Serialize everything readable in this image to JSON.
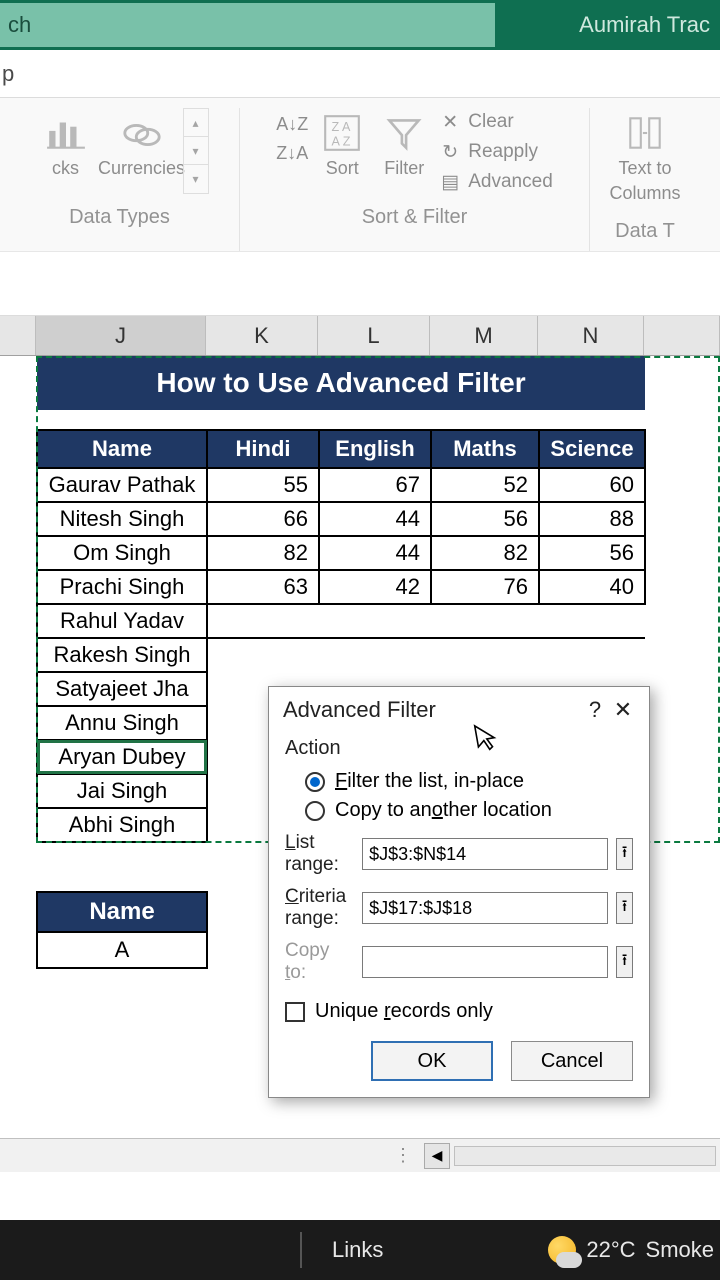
{
  "titlebar": {
    "search_text": "ch",
    "right_text": "Aumirah Trac"
  },
  "fnbar": {
    "text": "p"
  },
  "ribbon": {
    "data_types": {
      "stocks": "cks",
      "currencies": "Currencies",
      "group_label": "Data Types"
    },
    "sort_filter": {
      "sort": "Sort",
      "filter": "Filter",
      "clear": "Clear",
      "reapply": "Reapply",
      "advanced": "Advanced",
      "group_label": "Sort & Filter"
    },
    "data_tools": {
      "text_to_columns_l1": "Text to",
      "text_to_columns_l2": "Columns",
      "group_label": "Data T"
    }
  },
  "columns": {
    "J": "J",
    "K": "K",
    "L": "L",
    "M": "M",
    "N": "N"
  },
  "banner": "How to Use Advanced Filter",
  "headers": {
    "name": "Name",
    "hindi": "Hindi",
    "english": "English",
    "maths": "Maths",
    "science": "Science"
  },
  "rows": [
    {
      "name": "Gaurav Pathak",
      "hindi": 55,
      "english": 67,
      "maths": 52,
      "science": 60
    },
    {
      "name": "Nitesh Singh",
      "hindi": 66,
      "english": 44,
      "maths": 56,
      "science": 88
    },
    {
      "name": "Om Singh",
      "hindi": 82,
      "english": 44,
      "maths": 82,
      "science": 56
    },
    {
      "name": "Prachi Singh",
      "hindi": 63,
      "english": 42,
      "maths": 76,
      "science": 40
    },
    {
      "name": "Rahul Yadav"
    },
    {
      "name": "Rakesh Singh"
    },
    {
      "name": "Satyajeet Jha"
    },
    {
      "name": "Annu Singh"
    },
    {
      "name": "Aryan Dubey"
    },
    {
      "name": "Jai Singh"
    },
    {
      "name": "Abhi Singh"
    }
  ],
  "criteria": {
    "header": "Name",
    "value": "A"
  },
  "dialog": {
    "title": "Advanced Filter",
    "action_label": "Action",
    "opt_inplace": "Filter the list, in-place",
    "opt_copy": "Copy to another location",
    "list_range_label": "List range:",
    "list_range_value": "$J$3:$N$14",
    "criteria_range_label": "Criteria range:",
    "criteria_range_value": "$J$17:$J$18",
    "copy_to_label": "Copy to:",
    "copy_to_value": "",
    "unique_label": "Unique records only",
    "ok": "OK",
    "cancel": "Cancel"
  },
  "statusbar": {
    "links": "Links"
  },
  "weather": {
    "temp": "22°C",
    "cond": "Smoke"
  }
}
